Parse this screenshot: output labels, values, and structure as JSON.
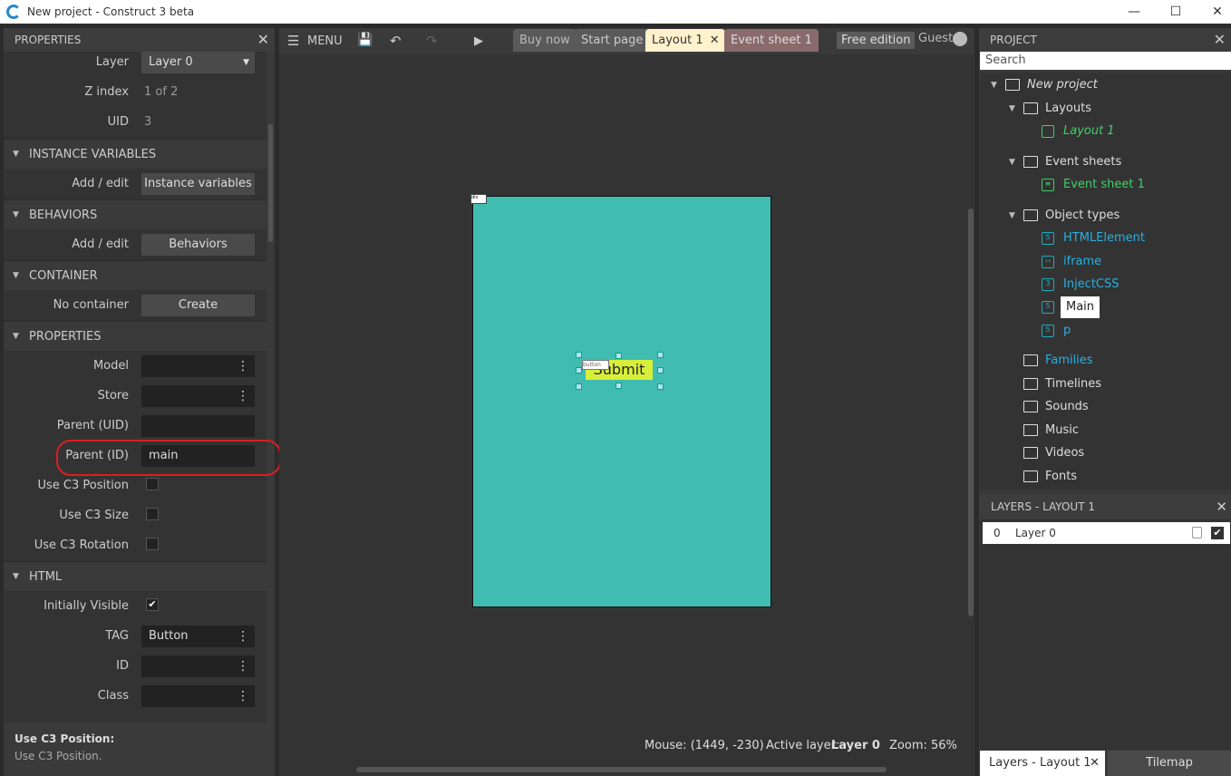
{
  "window": {
    "title": "New project - Construct 3 beta",
    "minimize": "—",
    "maximize": "☐",
    "close": "✕"
  },
  "properties_panel": {
    "title": "PROPERTIES",
    "close": "✕",
    "rows": {
      "layer_label": "Layer",
      "layer_value": "Layer 0",
      "zindex_label": "Z index",
      "zindex_value": "1 of 2",
      "uid_label": "UID",
      "uid_value": "3",
      "instvars_section": "INSTANCE VARIABLES",
      "instvars_label": "Add / edit",
      "instvars_button": "Instance variables",
      "behaviors_section": "BEHAVIORS",
      "behaviors_label": "Add / edit",
      "behaviors_button": "Behaviors",
      "container_section": "CONTAINER",
      "container_label": "No container",
      "container_button": "Create",
      "properties_section": "PROPERTIES",
      "model_label": "Model",
      "store_label": "Store",
      "parent_uid_label": "Parent (UID)",
      "parent_uid_value": "",
      "parent_id_label": "Parent (ID)",
      "parent_id_value": "main",
      "use_pos_label": "Use C3 Position",
      "use_size_label": "Use C3 Size",
      "use_rot_label": "Use C3 Rotation",
      "html_section": "HTML",
      "visible_label": "Initially Visible",
      "visible_check": "✔",
      "tag_label": "TAG",
      "tag_value": "Button",
      "id_label": "ID",
      "class_label": "Class"
    },
    "help_title": "Use C3 Position:",
    "help_text": "Use C3 Position."
  },
  "toolbar": {
    "menu": "MENU",
    "tabs": {
      "buy": "Buy now",
      "start": "Start page",
      "layout": "Layout 1",
      "layout_close": "✕",
      "events": "Event sheet 1"
    },
    "edition": "Free edition",
    "user": "Guest"
  },
  "canvas": {
    "button_text": "Submit",
    "button_tag": "button",
    "origin_tag": "div"
  },
  "status": {
    "mouse": "Mouse: (1449, -230)",
    "active_layer_label": "Active layer:",
    "active_layer_value": "Layer 0",
    "zoom": "Zoom: 56%"
  },
  "project_panel": {
    "title": "PROJECT",
    "close": "✕",
    "search_placeholder": "Search",
    "tree": {
      "root": "New project",
      "layouts": "Layouts",
      "layout1": "Layout 1",
      "eventsheets": "Event sheets",
      "eventsheet1": "Event sheet 1",
      "objecttypes": "Object types",
      "obj_html": "HTMLElement",
      "obj_iframe": "iframe",
      "obj_css": "InjectCSS",
      "obj_main": "Main",
      "obj_p": "p",
      "families": "Families",
      "timelines": "Timelines",
      "sounds": "Sounds",
      "music": "Music",
      "videos": "Videos",
      "fonts": "Fonts"
    }
  },
  "layers_panel": {
    "title": "LAYERS - LAYOUT 1",
    "close": "✕",
    "layer_index": "0",
    "layer_name": "Layer 0",
    "tabs": {
      "layers": "Layers - Layout 1",
      "tilemap": "Tilemap",
      "close": "✕"
    }
  },
  "colors": {
    "accent_green": "#3fd066",
    "layout_bg": "#40bcb1",
    "annotation": "#d81f26"
  }
}
